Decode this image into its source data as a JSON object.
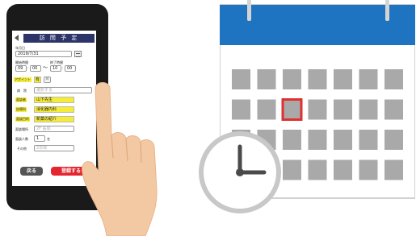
{
  "phone": {
    "title": "訪 問 予 定",
    "date_label": "年月日",
    "date_value": "2019/7/31",
    "start_label": "開始時間",
    "end_label": "終了時間",
    "start_hour": "09",
    "start_min": "00",
    "tilde": "〜",
    "end_hour": "10",
    "end_min": "00",
    "appointment_label": "アポイント",
    "appointment_yes": "有",
    "appointment_no": "無",
    "hospital_label": "病　院",
    "hospital_placeholder": "選択する",
    "doctor_label": "面談者",
    "doctor_value": "山下先生",
    "department_label": "診療科",
    "department_value": "消化器内科",
    "purpose_label": "面談目的",
    "purpose_value": "新薬の紹介",
    "place_label": "面談場所",
    "place_placeholder": "2F 医局",
    "count_label": "面談人数",
    "count_value": "1",
    "count_unit": "名",
    "other_label": "その他",
    "other_placeholder": "2日目",
    "back_button": "戻る",
    "register_button": "登録する"
  },
  "colors": {
    "calendar_header": "#1f74c1",
    "calendar_cell": "#a9a9a9",
    "highlight": "#e03030",
    "highlight_yellow": "#f5ec3a",
    "title_bar": "#2c3468",
    "register_button": "#e3262f",
    "back_button": "#555555",
    "clock_border": "#c8c8c8",
    "skin": "#f3c9a3"
  },
  "icons": [
    "calendar-icon",
    "clock-icon",
    "hand-icon",
    "calendar-picker-icon",
    "back-arrow-icon"
  ]
}
